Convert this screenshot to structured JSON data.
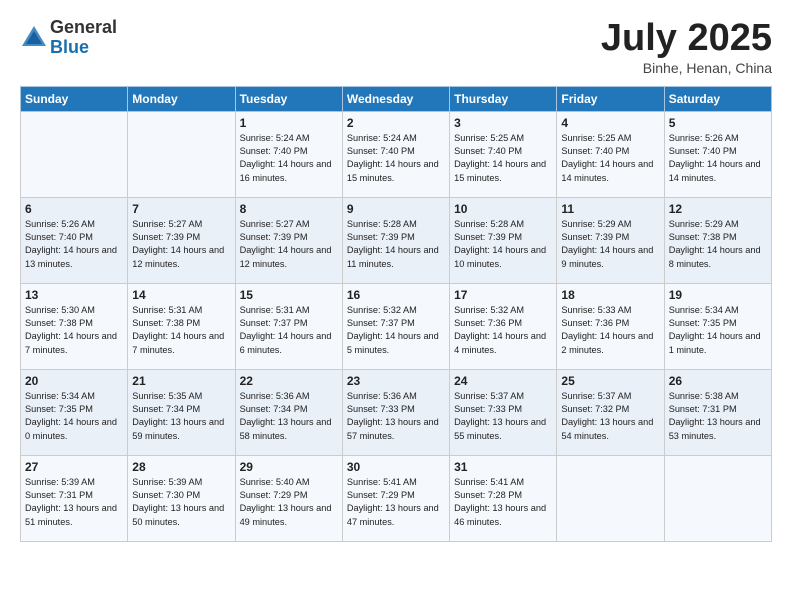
{
  "header": {
    "logo_general": "General",
    "logo_blue": "Blue",
    "month_title": "July 2025",
    "location": "Binhe, Henan, China"
  },
  "days_of_week": [
    "Sunday",
    "Monday",
    "Tuesday",
    "Wednesday",
    "Thursday",
    "Friday",
    "Saturday"
  ],
  "weeks": [
    [
      {
        "day": "",
        "info": ""
      },
      {
        "day": "",
        "info": ""
      },
      {
        "day": "1",
        "info": "Sunrise: 5:24 AM\nSunset: 7:40 PM\nDaylight: 14 hours and 16 minutes."
      },
      {
        "day": "2",
        "info": "Sunrise: 5:24 AM\nSunset: 7:40 PM\nDaylight: 14 hours and 15 minutes."
      },
      {
        "day": "3",
        "info": "Sunrise: 5:25 AM\nSunset: 7:40 PM\nDaylight: 14 hours and 15 minutes."
      },
      {
        "day": "4",
        "info": "Sunrise: 5:25 AM\nSunset: 7:40 PM\nDaylight: 14 hours and 14 minutes."
      },
      {
        "day": "5",
        "info": "Sunrise: 5:26 AM\nSunset: 7:40 PM\nDaylight: 14 hours and 14 minutes."
      }
    ],
    [
      {
        "day": "6",
        "info": "Sunrise: 5:26 AM\nSunset: 7:40 PM\nDaylight: 14 hours and 13 minutes."
      },
      {
        "day": "7",
        "info": "Sunrise: 5:27 AM\nSunset: 7:39 PM\nDaylight: 14 hours and 12 minutes."
      },
      {
        "day": "8",
        "info": "Sunrise: 5:27 AM\nSunset: 7:39 PM\nDaylight: 14 hours and 12 minutes."
      },
      {
        "day": "9",
        "info": "Sunrise: 5:28 AM\nSunset: 7:39 PM\nDaylight: 14 hours and 11 minutes."
      },
      {
        "day": "10",
        "info": "Sunrise: 5:28 AM\nSunset: 7:39 PM\nDaylight: 14 hours and 10 minutes."
      },
      {
        "day": "11",
        "info": "Sunrise: 5:29 AM\nSunset: 7:39 PM\nDaylight: 14 hours and 9 minutes."
      },
      {
        "day": "12",
        "info": "Sunrise: 5:29 AM\nSunset: 7:38 PM\nDaylight: 14 hours and 8 minutes."
      }
    ],
    [
      {
        "day": "13",
        "info": "Sunrise: 5:30 AM\nSunset: 7:38 PM\nDaylight: 14 hours and 7 minutes."
      },
      {
        "day": "14",
        "info": "Sunrise: 5:31 AM\nSunset: 7:38 PM\nDaylight: 14 hours and 7 minutes."
      },
      {
        "day": "15",
        "info": "Sunrise: 5:31 AM\nSunset: 7:37 PM\nDaylight: 14 hours and 6 minutes."
      },
      {
        "day": "16",
        "info": "Sunrise: 5:32 AM\nSunset: 7:37 PM\nDaylight: 14 hours and 5 minutes."
      },
      {
        "day": "17",
        "info": "Sunrise: 5:32 AM\nSunset: 7:36 PM\nDaylight: 14 hours and 4 minutes."
      },
      {
        "day": "18",
        "info": "Sunrise: 5:33 AM\nSunset: 7:36 PM\nDaylight: 14 hours and 2 minutes."
      },
      {
        "day": "19",
        "info": "Sunrise: 5:34 AM\nSunset: 7:35 PM\nDaylight: 14 hours and 1 minute."
      }
    ],
    [
      {
        "day": "20",
        "info": "Sunrise: 5:34 AM\nSunset: 7:35 PM\nDaylight: 14 hours and 0 minutes."
      },
      {
        "day": "21",
        "info": "Sunrise: 5:35 AM\nSunset: 7:34 PM\nDaylight: 13 hours and 59 minutes."
      },
      {
        "day": "22",
        "info": "Sunrise: 5:36 AM\nSunset: 7:34 PM\nDaylight: 13 hours and 58 minutes."
      },
      {
        "day": "23",
        "info": "Sunrise: 5:36 AM\nSunset: 7:33 PM\nDaylight: 13 hours and 57 minutes."
      },
      {
        "day": "24",
        "info": "Sunrise: 5:37 AM\nSunset: 7:33 PM\nDaylight: 13 hours and 55 minutes."
      },
      {
        "day": "25",
        "info": "Sunrise: 5:37 AM\nSunset: 7:32 PM\nDaylight: 13 hours and 54 minutes."
      },
      {
        "day": "26",
        "info": "Sunrise: 5:38 AM\nSunset: 7:31 PM\nDaylight: 13 hours and 53 minutes."
      }
    ],
    [
      {
        "day": "27",
        "info": "Sunrise: 5:39 AM\nSunset: 7:31 PM\nDaylight: 13 hours and 51 minutes."
      },
      {
        "day": "28",
        "info": "Sunrise: 5:39 AM\nSunset: 7:30 PM\nDaylight: 13 hours and 50 minutes."
      },
      {
        "day": "29",
        "info": "Sunrise: 5:40 AM\nSunset: 7:29 PM\nDaylight: 13 hours and 49 minutes."
      },
      {
        "day": "30",
        "info": "Sunrise: 5:41 AM\nSunset: 7:29 PM\nDaylight: 13 hours and 47 minutes."
      },
      {
        "day": "31",
        "info": "Sunrise: 5:41 AM\nSunset: 7:28 PM\nDaylight: 13 hours and 46 minutes."
      },
      {
        "day": "",
        "info": ""
      },
      {
        "day": "",
        "info": ""
      }
    ]
  ]
}
